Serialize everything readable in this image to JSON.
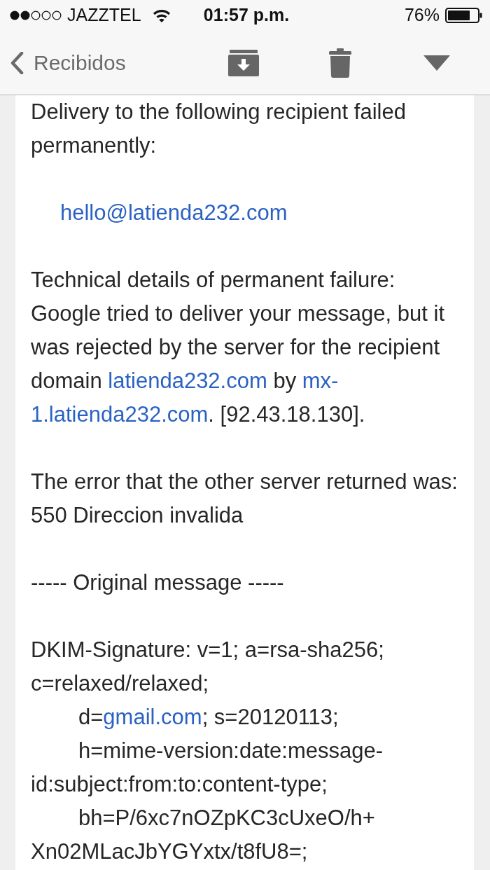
{
  "status_bar": {
    "carrier": "JAZZTEL",
    "time": "01:57 p.m.",
    "battery": "76%"
  },
  "nav_bar": {
    "back_label": "Recibidos"
  },
  "message": {
    "paragraphs": [
      {
        "kind": "text",
        "lines": [
          {
            "indented": false,
            "parts": [
              {
                "kind": "text",
                "text": "Delivery to the following recipient failed"
              }
            ]
          },
          {
            "indented": false,
            "parts": [
              {
                "kind": "text",
                "text": "permanently:"
              }
            ]
          }
        ]
      },
      {
        "kind": "address",
        "lines": [
          {
            "indented": false,
            "parts": [
              {
                "kind": "link",
                "text": "hello@latienda232.com"
              }
            ]
          }
        ]
      },
      {
        "kind": "text",
        "lines": [
          {
            "indented": false,
            "parts": [
              {
                "kind": "text",
                "text": "Technical details of permanent failure:"
              }
            ]
          },
          {
            "indented": false,
            "parts": [
              {
                "kind": "text",
                "text": "Google tried to deliver your message, but it"
              }
            ]
          },
          {
            "indented": false,
            "parts": [
              {
                "kind": "text",
                "text": "was rejected by the server for the recipient"
              }
            ]
          },
          {
            "indented": false,
            "parts": [
              {
                "kind": "text",
                "text": "domain "
              },
              {
                "kind": "link",
                "text": "latienda232.com"
              },
              {
                "kind": "text",
                "text": " by "
              },
              {
                "kind": "link",
                "text": "mx-"
              }
            ]
          },
          {
            "indented": false,
            "parts": [
              {
                "kind": "link",
                "text": "1.latienda232.com"
              },
              {
                "kind": "text",
                "text": ". [92.43.18.130]."
              }
            ]
          }
        ]
      },
      {
        "kind": "text",
        "lines": [
          {
            "indented": false,
            "parts": [
              {
                "kind": "text",
                "text": "The error that the other server returned was:"
              }
            ]
          },
          {
            "indented": false,
            "parts": [
              {
                "kind": "text",
                "text": "550 Direccion invalida"
              }
            ]
          }
        ]
      },
      {
        "kind": "text",
        "lines": [
          {
            "indented": false,
            "parts": [
              {
                "kind": "text",
                "text": "----- Original message -----"
              }
            ]
          }
        ]
      },
      {
        "kind": "text",
        "lines": [
          {
            "indented": false,
            "parts": [
              {
                "kind": "text",
                "text": "DKIM-Signature: v=1; a=rsa-sha256;"
              }
            ]
          },
          {
            "indented": false,
            "parts": [
              {
                "kind": "text",
                "text": "c=relaxed/relaxed;"
              }
            ]
          },
          {
            "indented": true,
            "parts": [
              {
                "kind": "text",
                "text": "d="
              },
              {
                "kind": "link",
                "text": "gmail.com"
              },
              {
                "kind": "text",
                "text": "; s=20120113;"
              }
            ]
          },
          {
            "indented": true,
            "parts": [
              {
                "kind": "text",
                "text": "h=mime-version:date:message-"
              }
            ]
          },
          {
            "indented": false,
            "parts": [
              {
                "kind": "text",
                "text": "id:subject:from:to:content-type;"
              }
            ]
          },
          {
            "indented": true,
            "parts": [
              {
                "kind": "text",
                "text": "bh=P/6xc7nOZpKC3cUxeO/h+"
              }
            ]
          },
          {
            "indented": false,
            "parts": [
              {
                "kind": "text",
                "text": "Xn02MLacJbYGYxtx/t8fU8=;"
              }
            ]
          }
        ]
      }
    ]
  }
}
